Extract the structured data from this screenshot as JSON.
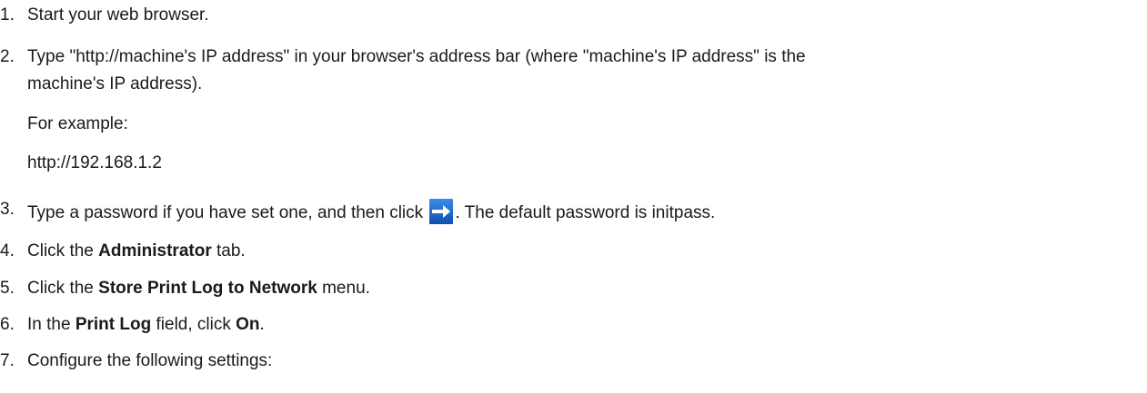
{
  "steps": [
    {
      "number": "1.",
      "text": "Start your web browser."
    },
    {
      "number": "2.",
      "line1": "Type \"http://machine's IP address\" in your browser's address bar (where \"machine's IP address\" is the",
      "line2": "machine's IP address).",
      "example_label": "For example:",
      "example_value": "http://192.168.1.2"
    },
    {
      "number": "3.",
      "before_icon": "Type a password if you have set one, and then click ",
      "icon": "arrow-right-icon",
      "after_icon": ". The default password is initpass."
    },
    {
      "number": "4.",
      "before": "Click the ",
      "bold": "Administrator",
      "after": " tab."
    },
    {
      "number": "5.",
      "before": "Click the ",
      "bold": "Store Print Log to Network",
      "after": " menu."
    },
    {
      "number": "6.",
      "before": "In the ",
      "bold": "Print Log",
      "middle": " field, click ",
      "bold2": "On",
      "after": "."
    },
    {
      "number": "7.",
      "text": "Configure the following settings:"
    }
  ],
  "colors": {
    "icon_blue": "#1f6fd6",
    "icon_blue_dark": "#0f4fae",
    "text": "#1a1a1a"
  }
}
